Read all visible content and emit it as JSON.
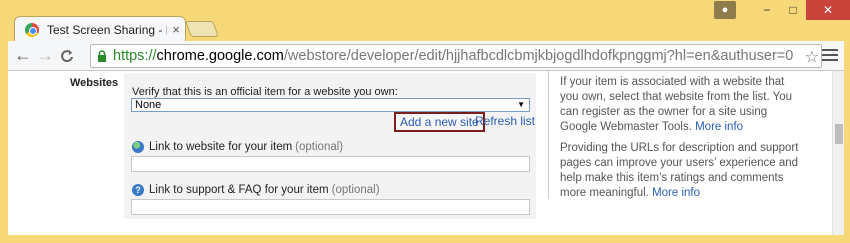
{
  "browser": {
    "tab_title": "Test Screen Sharing - Edit",
    "tab_close": "×",
    "url_scheme": "https://",
    "url_host": "chrome.google.com",
    "url_path": "/webstore/developer/edit/hjjhafbcdlcbmjkbjogdlhdofkpnggmj?hl=en&authuser=0",
    "back_glyph": "←",
    "forward_glyph": "→",
    "reload_glyph": "C",
    "star_glyph": "☆",
    "minimize_glyph": "−",
    "maximize_glyph": "□",
    "close_glyph": "✕",
    "icons": [
      "chrome-favicon",
      "user-icon",
      "lock-icon",
      "star-icon",
      "menu-icon"
    ]
  },
  "websites_section": {
    "label": "Websites",
    "verify_label": "Verify that this is an official item for a website you own:",
    "select_value": "None",
    "add_site_label": "Add a new site",
    "refresh_label": "Refresh list",
    "website_link_label": "Link to website for your item",
    "website_link_optional": "(optional)",
    "support_link_label": "Link to support & FAQ for your item",
    "support_link_optional": "(optional)"
  },
  "sidebar_help": {
    "para1": "If your item is associated with a website that you own, select that website from the list. You can register as the owner for a site using Google Webmaster Tools.",
    "para1_more": "More info",
    "para2": "Providing the URLs for description and support pages can improve your users’ experience and help make this item’s ratings and comments more meaningful.",
    "para2_more": "More info"
  },
  "colors": {
    "frame": "#f6d878",
    "link": "#2a5db0",
    "https_green": "#2a8a2a",
    "highlight_border": "#7b1e1e"
  }
}
